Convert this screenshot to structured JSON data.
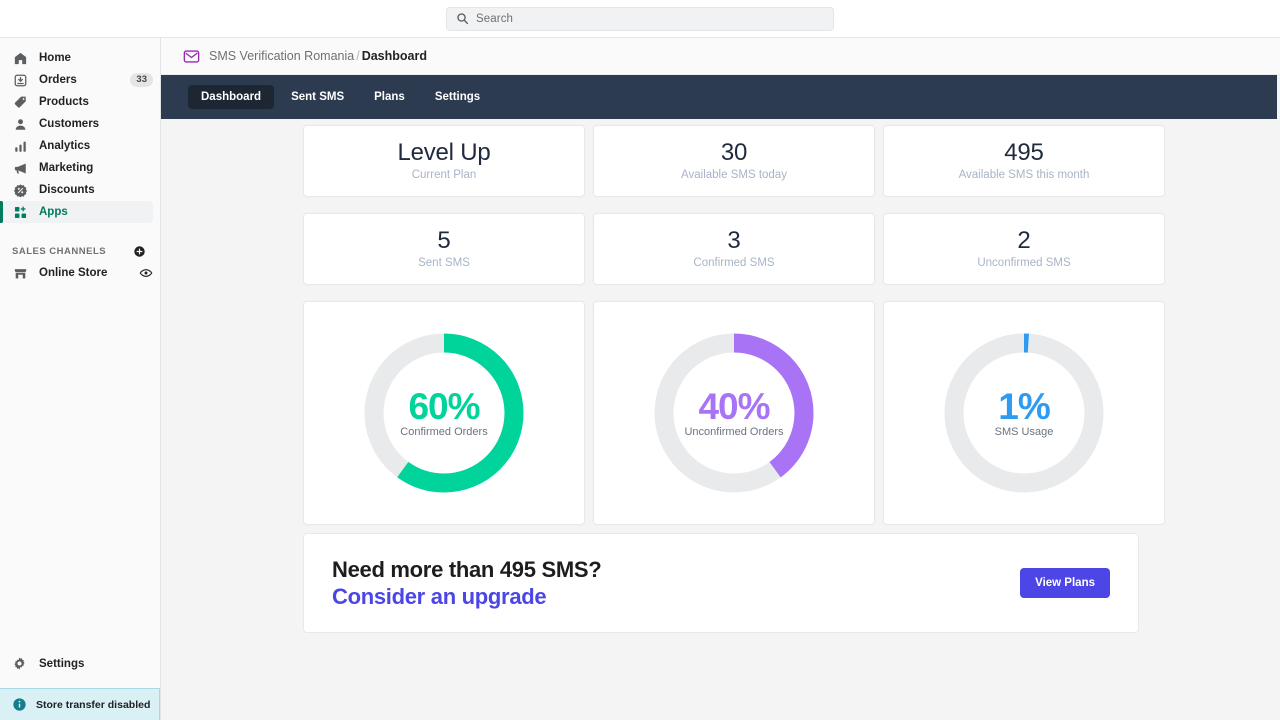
{
  "search": {
    "placeholder": "Search",
    "icon": "search-icon"
  },
  "sidebar": {
    "items": [
      {
        "label": "Home",
        "icon": "home-icon",
        "badge": ""
      },
      {
        "label": "Orders",
        "icon": "orders-icon",
        "badge": "33"
      },
      {
        "label": "Products",
        "icon": "tag-icon",
        "badge": ""
      },
      {
        "label": "Customers",
        "icon": "person-icon",
        "badge": ""
      },
      {
        "label": "Analytics",
        "icon": "bar-chart-icon",
        "badge": ""
      },
      {
        "label": "Marketing",
        "icon": "megaphone-icon",
        "badge": ""
      },
      {
        "label": "Discounts",
        "icon": "discount-icon",
        "badge": ""
      },
      {
        "label": "Apps",
        "icon": "apps-icon",
        "badge": ""
      }
    ],
    "active_item": "Apps",
    "section": {
      "title": "SALES CHANNELS",
      "add_icon": "plus-circle-icon"
    },
    "channels": [
      {
        "label": "Online Store",
        "icon": "store-icon",
        "action_icon": "eye-icon"
      }
    ],
    "settings": {
      "label": "Settings",
      "icon": "gear-icon"
    },
    "store_banner": {
      "label": "Store transfer disabled",
      "icon": "info-icon",
      "accent": "#d9f0f5"
    }
  },
  "breadcrumb": {
    "icon": "envelope-icon",
    "app": "SMS Verification Romania",
    "separator": "/",
    "current": "Dashboard"
  },
  "app_nav": {
    "tabs": [
      {
        "label": "Dashboard",
        "active": true
      },
      {
        "label": "Sent SMS",
        "active": false
      },
      {
        "label": "Plans",
        "active": false
      },
      {
        "label": "Settings",
        "active": false
      }
    ],
    "bg": "#2c3b4f",
    "active_bg": "#1d2733"
  },
  "stats": [
    {
      "value": "Level Up",
      "label": "Current Plan"
    },
    {
      "value": "30",
      "label": "Available SMS today"
    },
    {
      "value": "495",
      "label": "Available SMS this month"
    },
    {
      "value": "5",
      "label": "Sent SMS"
    },
    {
      "value": "3",
      "label": "Confirmed SMS"
    },
    {
      "value": "2",
      "label": "Unconfirmed SMS"
    }
  ],
  "chart_data": [
    {
      "type": "pie",
      "title": "Confirmed Orders",
      "percent_label": "60%",
      "values": [
        60,
        40
      ],
      "categories": [
        "Confirmed Orders",
        "Remaining"
      ],
      "color": "#00d49b",
      "track_color": "#e9eaeb"
    },
    {
      "type": "pie",
      "title": "Unconfirmed Orders",
      "percent_label": "40%",
      "values": [
        40,
        60
      ],
      "categories": [
        "Unconfirmed Orders",
        "Remaining"
      ],
      "color": "#a874f5",
      "track_color": "#e9eaeb"
    },
    {
      "type": "pie",
      "title": "SMS Usage",
      "percent_label": "1%",
      "values": [
        1,
        99
      ],
      "categories": [
        "SMS Usage",
        "Remaining"
      ],
      "color": "#2e9bf2",
      "track_color": "#e9eaeb"
    }
  ],
  "upgrade_banner": {
    "line1": "Need more than 495 SMS?",
    "line2": "Consider an upgrade",
    "button": "View Plans",
    "accent": "#4b46e5"
  }
}
